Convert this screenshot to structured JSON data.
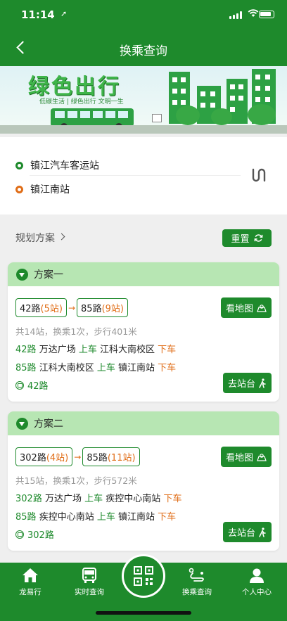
{
  "status": {
    "time": "11:14",
    "location_arrow": "➚"
  },
  "nav": {
    "title": "换乘查询"
  },
  "banner": {
    "slogan": "绿色出行",
    "subtitle": "低碳生活  |  绿色出行 文明一生"
  },
  "stops": {
    "origin": "镇江汽车客运站",
    "destination": "镇江南站"
  },
  "plan": {
    "label": "规划方案",
    "reset_label": "重置"
  },
  "colors": {
    "primary": "#1e8a2c",
    "accent": "#e06d17",
    "card_header": "#b7e6b3"
  },
  "plans": [
    {
      "title": "方案一",
      "routes": [
        {
          "name": "42路",
          "count": "(5站)"
        },
        {
          "name": "85路",
          "count": "(9站)"
        }
      ],
      "map_button": "看地图",
      "summary": "共14站，换乘1次，步行401米",
      "legs": [
        {
          "route": "42路",
          "from": "万达广场",
          "on": "上车",
          "to": "江科大南校区",
          "off": "下车"
        },
        {
          "route": "85路",
          "from": "江科大南校区",
          "on": "上车",
          "to": "镇江南站",
          "off": "下车"
        }
      ],
      "bus_line": "42路",
      "station_button": "去站台"
    },
    {
      "title": "方案二",
      "routes": [
        {
          "name": "302路",
          "count": "(4站)"
        },
        {
          "name": "85路",
          "count": "(11站)"
        }
      ],
      "map_button": "看地图",
      "summary": "共15站，换乘1次，步行572米",
      "legs": [
        {
          "route": "302路",
          "from": "万达广场",
          "on": "上车",
          "to": "疾控中心南站",
          "off": "下车"
        },
        {
          "route": "85路",
          "from": "疾控中心南站",
          "on": "上车",
          "to": "镇江南站",
          "off": "下车"
        }
      ],
      "bus_line": "302路",
      "station_button": "去站台"
    }
  ],
  "tabs": [
    {
      "label": "龙易行",
      "icon": "home-icon"
    },
    {
      "label": "实时查询",
      "icon": "bus-icon"
    },
    {
      "label": "",
      "icon": "qr-code-icon"
    },
    {
      "label": "换乘查询",
      "icon": "route-icon"
    },
    {
      "label": "个人中心",
      "icon": "user-icon"
    }
  ]
}
